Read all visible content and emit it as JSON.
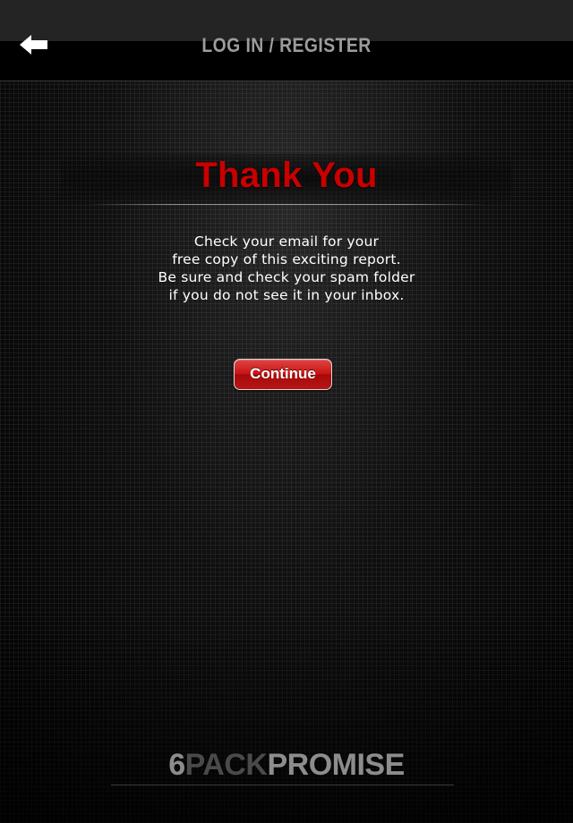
{
  "nav": {
    "title": "LOG IN / REGISTER",
    "back_icon": "back-arrow-icon"
  },
  "content": {
    "title": "Thank You",
    "message_lines": [
      "Check your email for your",
      "free copy of this exciting report.",
      "Be sure and check your spam folder",
      "if you do not see it in your inbox."
    ],
    "continue_label": "Continue"
  },
  "brand": {
    "part1": "6",
    "part2": "PACK",
    "part3": "PROMISE"
  },
  "colors": {
    "accent_red": "#c80000",
    "nav_title": "#9c9c9c",
    "background": "#0e0e0e"
  }
}
